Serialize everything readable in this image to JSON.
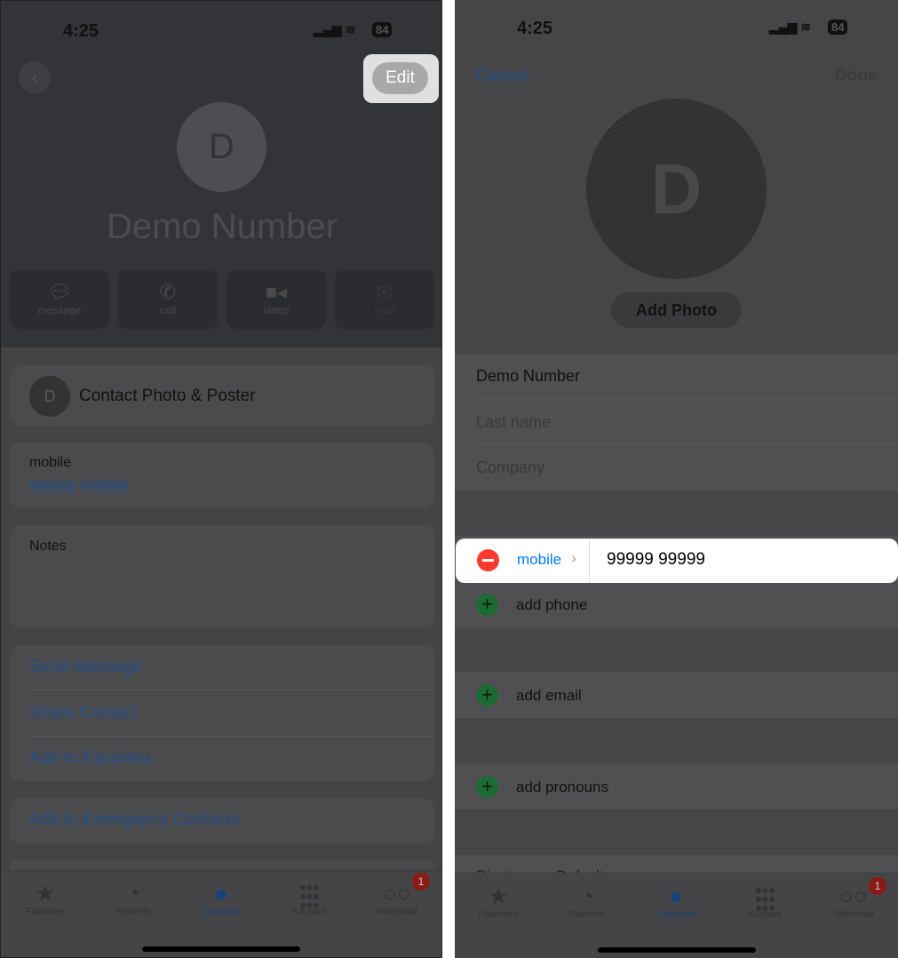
{
  "left": {
    "status": {
      "time": "4:25",
      "battery": "84"
    },
    "edit_label": "Edit",
    "avatar_initial": "D",
    "contact_name": "Demo Number",
    "actions": [
      {
        "label": "message",
        "icon": "message-icon"
      },
      {
        "label": "call",
        "icon": "phone-icon"
      },
      {
        "label": "video",
        "icon": "video-icon"
      },
      {
        "label": "mail",
        "icon": "mail-icon"
      }
    ],
    "photo_poster": "Contact Photo & Poster",
    "phone_label": "mobile",
    "phone_value": "99999 99999",
    "notes_label": "Notes",
    "links": [
      "Send Message",
      "Share Contact",
      "Add to Favorites"
    ],
    "emergency": "Add to Emergency Contacts"
  },
  "right": {
    "status": {
      "time": "4:25",
      "battery": "84"
    },
    "cancel": "Cancel",
    "done": "Done",
    "avatar_initial": "D",
    "add_photo": "Add Photo",
    "first_name": "Demo Number",
    "last_name_placeholder": "Last name",
    "company_placeholder": "Company",
    "phone_label": "mobile",
    "phone_value": "99999 99999",
    "add_phone": "add phone",
    "add_email": "add email",
    "add_pronouns": "add pronouns",
    "ringtone_label": "Ringtone",
    "ringtone_value": "Default"
  },
  "tabs": [
    {
      "label": "Favorites",
      "icon": "star-icon"
    },
    {
      "label": "Recents",
      "icon": "clock-icon"
    },
    {
      "label": "Contacts",
      "icon": "person-icon",
      "active": true
    },
    {
      "label": "Keypad",
      "icon": "keypad-icon"
    },
    {
      "label": "Voicemail",
      "icon": "voicemail-icon",
      "badge": "1"
    }
  ],
  "colors": {
    "link": "#007aff",
    "delete": "#ff3b30",
    "add": "#34c759",
    "highlight": "#ffffff"
  }
}
